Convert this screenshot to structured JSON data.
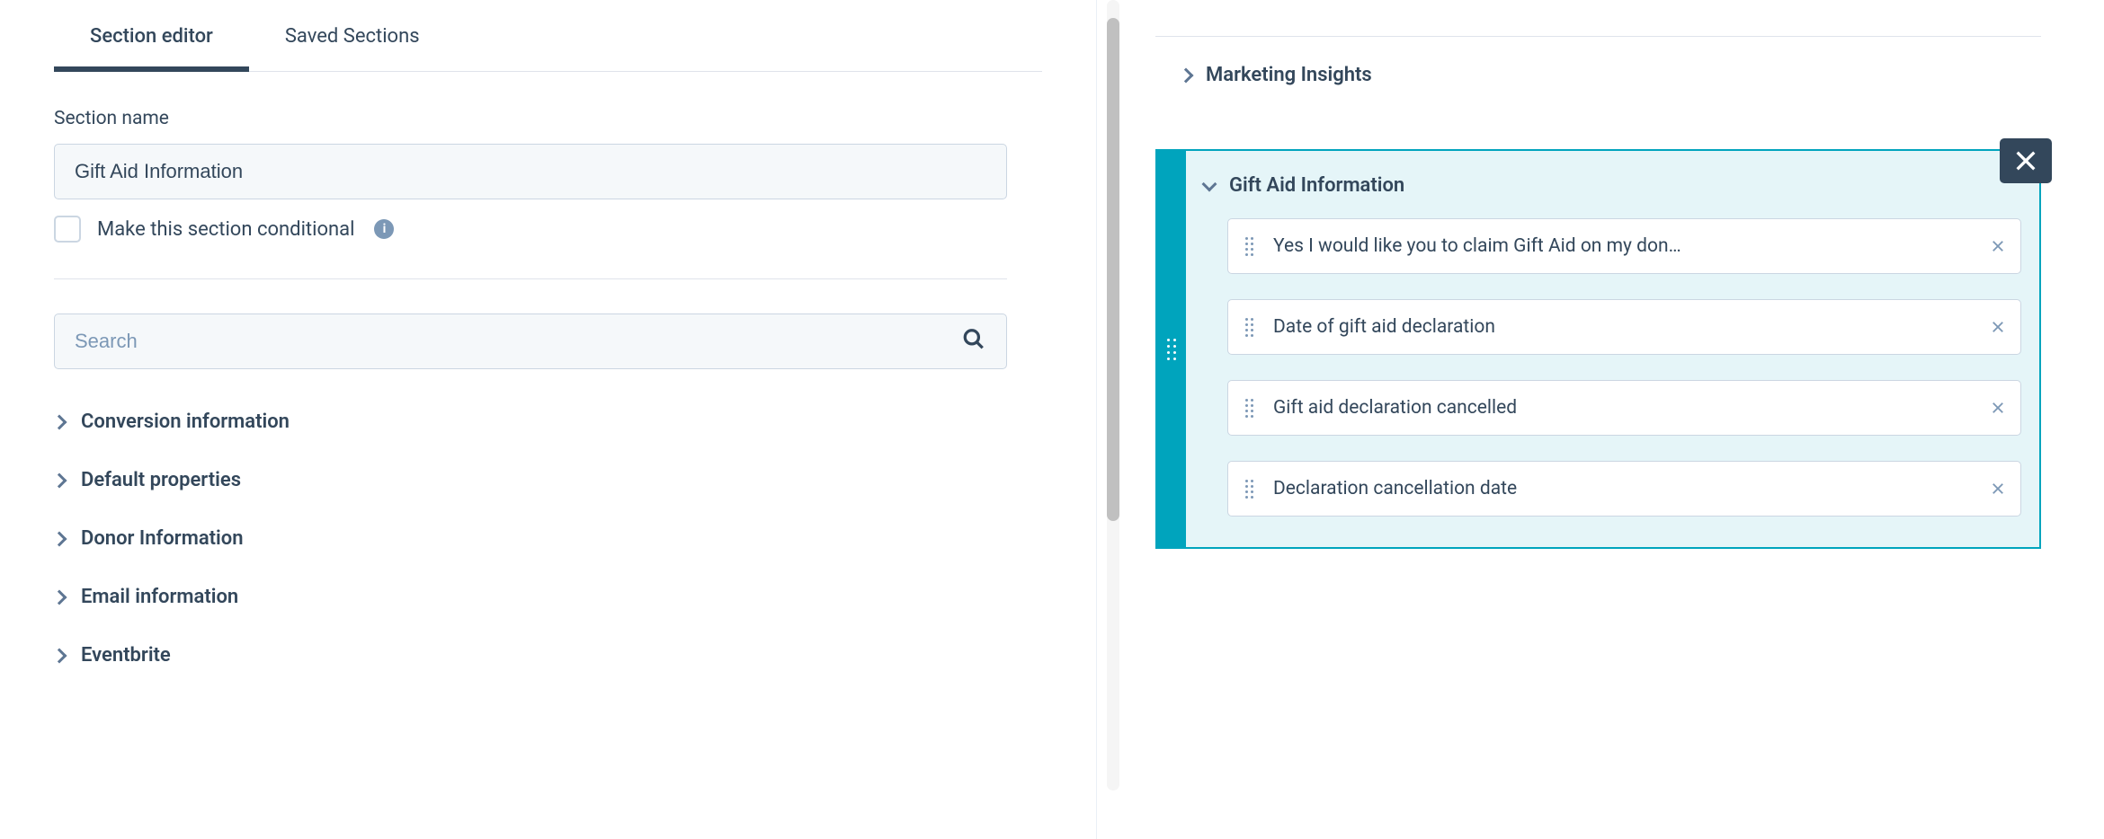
{
  "tabs": {
    "editor": "Section editor",
    "saved": "Saved Sections"
  },
  "form": {
    "section_name_label": "Section name",
    "section_name_value": "Gift Aid Information",
    "conditional_label": "Make this section conditional"
  },
  "search": {
    "placeholder": "Search"
  },
  "categories": [
    "Conversion information",
    "Default properties",
    "Donor Information",
    "Email information",
    "Eventbrite"
  ],
  "right": {
    "section_collapsed": "Marketing Insights",
    "section_expanded": "Gift Aid Information",
    "properties": [
      "Yes I would like you to claim Gift Aid on my don…",
      "Date of gift aid declaration",
      "Gift aid declaration cancelled",
      "Declaration cancellation date"
    ]
  }
}
